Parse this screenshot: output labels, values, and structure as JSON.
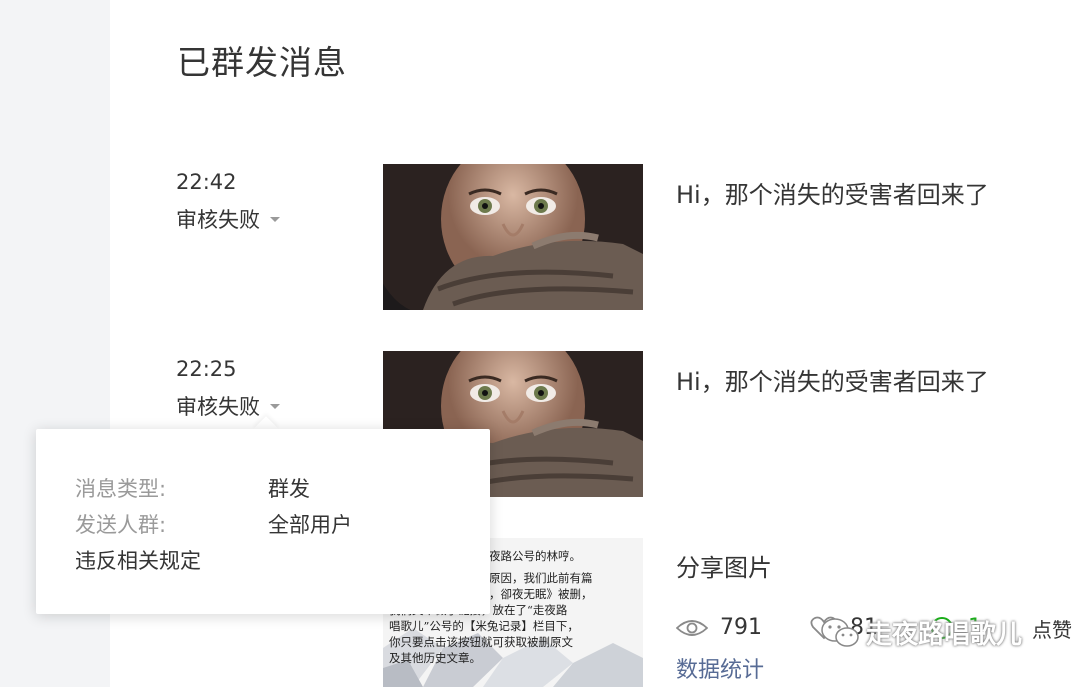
{
  "page": {
    "title": "已群发消息"
  },
  "messages": [
    {
      "time": "22:42",
      "status": "审核失败",
      "title": "Hi，那个消失的受害者回来了"
    },
    {
      "time": "22:25",
      "status": "审核失败",
      "title": "Hi，那个消失的受害者回来了"
    },
    {
      "title": "分享图片",
      "image_text": [
        "夜路公号的林哼。",
        "原因，我们此前有篇",
        "，卻夜无眠》被删，",
        "我们文章做了链接，放在了“走夜路",
        "唱歌儿”公号的【米兔记录】栏目下，",
        "你只要点击该按钮就可获取被删原文",
        "及其他历史文章。"
      ],
      "stats": {
        "views": "791",
        "likes": "81",
        "shares": "1",
        "likes_label": "点赞"
      },
      "data_link": "数据统计"
    }
  ],
  "popover": {
    "type_label": "消息类型:",
    "type_value": "群发",
    "audience_label": "发送人群:",
    "audience_value": "全部用户",
    "reason": "违反相关规定"
  },
  "watermark": {
    "text": "走夜路唱歌儿"
  },
  "colors": {
    "link": "#576b95",
    "text": "#353535",
    "muted": "#9a9a9a",
    "bg": "#f3f4f6"
  }
}
